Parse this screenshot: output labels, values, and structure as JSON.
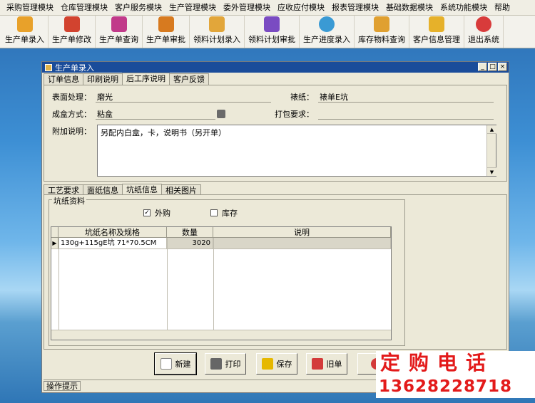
{
  "menu": [
    "采购管理模块",
    "仓库管理模块",
    "客户服务模块",
    "生产管理模块",
    "委外管理模块",
    "应收应付模块",
    "报表管理模块",
    "基础数据模块",
    "系统功能模块",
    "帮助"
  ],
  "toolbar": [
    {
      "label": "生产单录入",
      "icon": "order-entry-icon",
      "color": "#e8a12a"
    },
    {
      "label": "生产单修改",
      "icon": "order-edit-icon",
      "color": "#d2432f"
    },
    {
      "label": "生产单查询",
      "icon": "order-query-icon",
      "color": "#c13a8a"
    },
    {
      "label": "生产单审批",
      "icon": "order-approve-icon",
      "color": "#d77a1f"
    },
    {
      "label": "领料计划录入",
      "icon": "material-plan-icon",
      "color": "#e2a63a"
    },
    {
      "label": "领料计划审批",
      "icon": "material-approve-icon",
      "color": "#7a4bc2"
    },
    {
      "label": "生产进度录入",
      "icon": "progress-icon",
      "color": "#3a9ad4"
    },
    {
      "label": "库存物料查询",
      "icon": "inventory-icon",
      "color": "#e0a030"
    },
    {
      "label": "客户信息管理",
      "icon": "customer-icon",
      "color": "#e6b12a"
    },
    {
      "label": "退出系统",
      "icon": "exit-icon",
      "color": "#d83b3b"
    }
  ],
  "window": {
    "title": "生产单录入",
    "controls": [
      "_",
      "□",
      "×"
    ],
    "tabs": [
      "订单信息",
      "印刷说明",
      "后工序说明",
      "客户反馈"
    ],
    "active_tab": 2
  },
  "form": {
    "surface_label": "表面处理：",
    "surface_value": "磨光",
    "bead_label": "裱纸：",
    "bead_value": "裱单E坑",
    "box_label": "成盒方式：",
    "box_value": "粘盒",
    "pack_label": "打包要求：",
    "pack_value": "",
    "note_label": "附加说明：",
    "note_value": "另配内白盒，卡，说明书（另开单）"
  },
  "subtabs": {
    "tabs": [
      "工艺要求",
      "面纸信息",
      "坑纸信息",
      "相关图片"
    ],
    "active_tab": 2
  },
  "corrugated": {
    "group_title": "坑纸资料",
    "outsource_label": "外购",
    "outsource_checked": true,
    "stock_label": "库存",
    "stock_checked": false,
    "columns": [
      "坑纸名称及规格",
      "数量",
      "说明"
    ],
    "rows": [
      {
        "spec": "130g+115gE坑  71*70.5CM",
        "qty": "3020",
        "desc": ""
      }
    ]
  },
  "actions": [
    {
      "label": "新建",
      "icon": "new-doc-icon",
      "color": "#ffffff"
    },
    {
      "label": "打印",
      "icon": "printer-icon",
      "color": "#666666"
    },
    {
      "label": "保存",
      "icon": "save-icon",
      "color": "#e6b800"
    },
    {
      "label": "旧单",
      "icon": "old-order-icon",
      "color": "#d33a3a"
    },
    {
      "label": "",
      "icon": "close-icon",
      "color": "#d33a3a"
    }
  ],
  "status": {
    "hint": "操作提示"
  },
  "ad": {
    "line1": "定购电话",
    "line2": "13628228718"
  }
}
